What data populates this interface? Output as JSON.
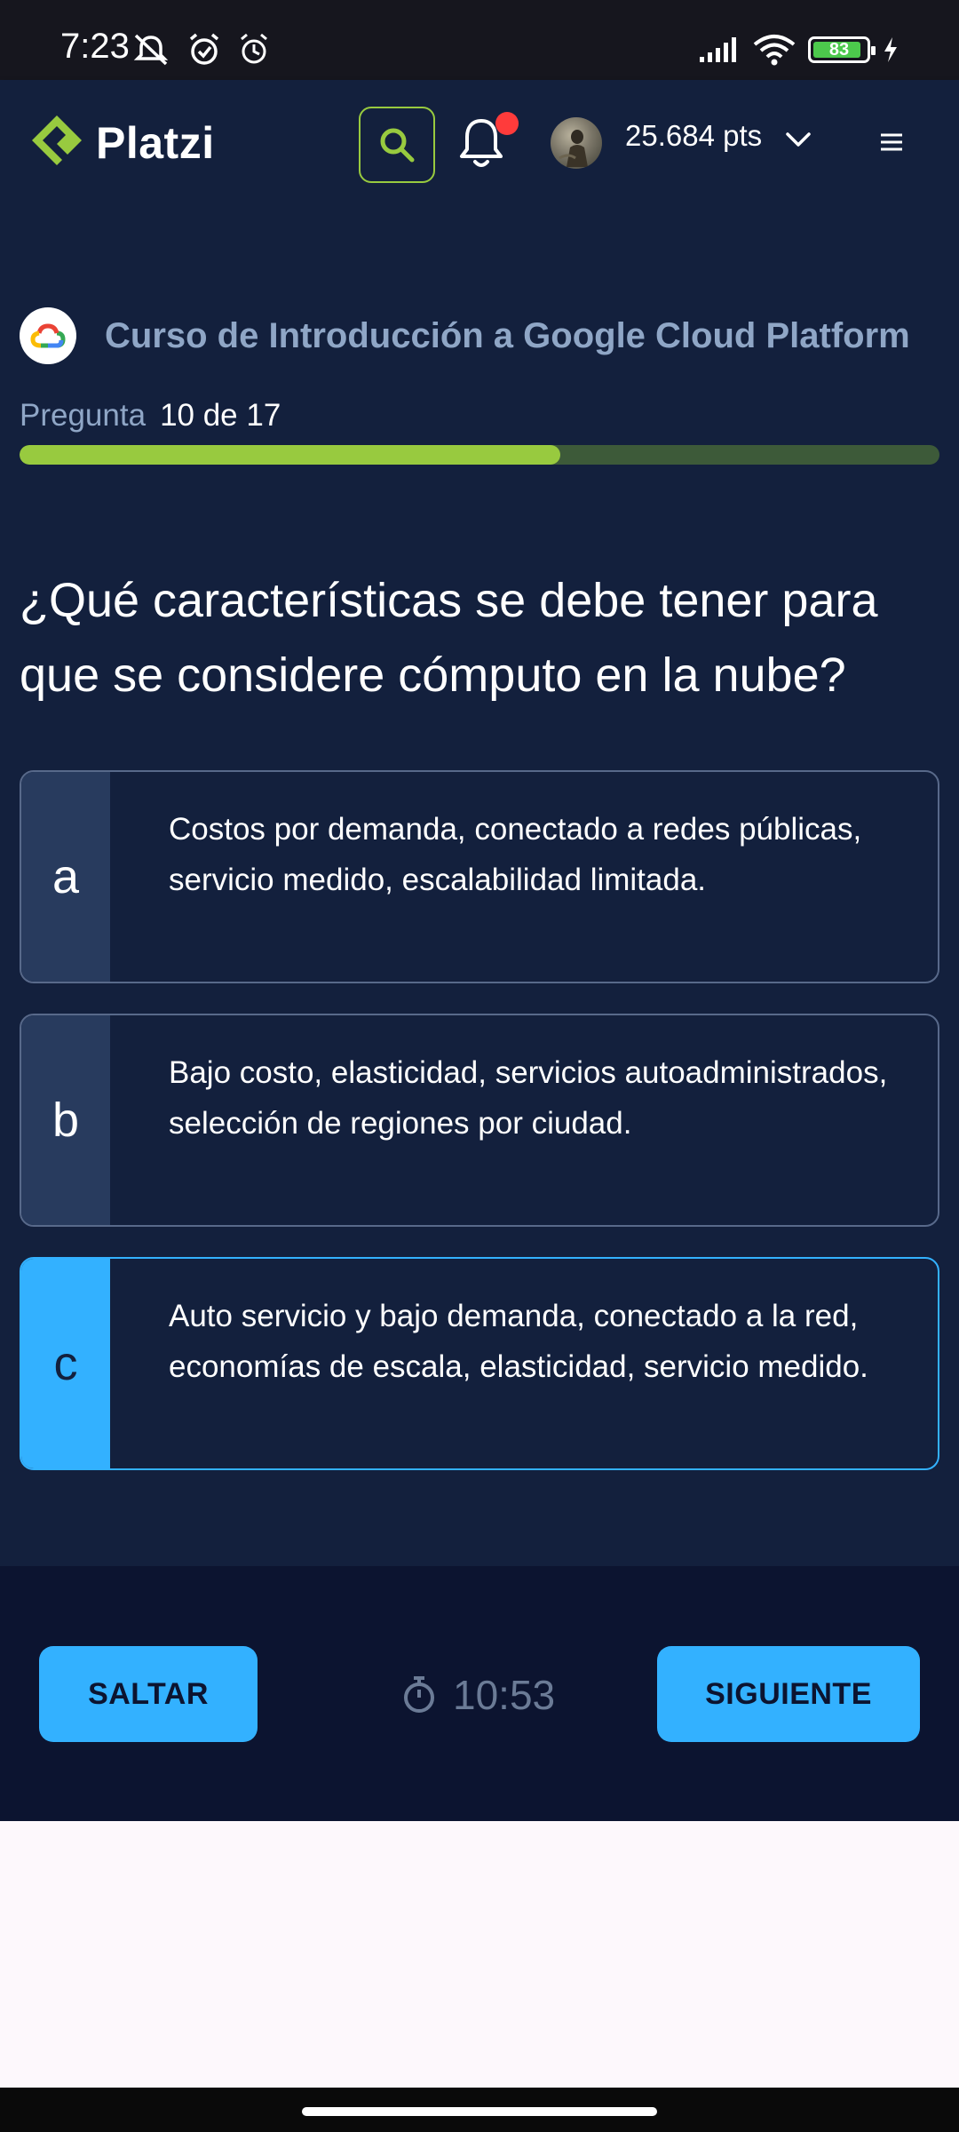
{
  "status_bar": {
    "time": "7:23",
    "battery": "83"
  },
  "header": {
    "logo_text": "Platzi",
    "points": "25.684 pts",
    "colors": {
      "accent": "#98ca3f",
      "notification": "#ff3b3b"
    }
  },
  "quiz": {
    "course_title": "Curso de Introducción a Google Cloud Platform",
    "progress_label": "Pregunta",
    "progress_value": "10 de 17",
    "progress_fraction": 0.588,
    "question": "¿Qué características se debe tener para que se considere cómputo en la nube?",
    "options": [
      {
        "letter": "a",
        "text": "Costos por demanda, conectado a redes públicas, servicio medido, escalabilidad limitada.",
        "selected": false
      },
      {
        "letter": "b",
        "text": "Bajo costo, elasticidad, servicios autoadministrados, selección de regiones por ciudad.",
        "selected": false
      },
      {
        "letter": "c",
        "text": "Auto servicio y bajo demanda, conectado a la red, economías de escala, elasticidad, servicio medido.",
        "selected": true
      }
    ]
  },
  "footer": {
    "skip_label": "SALTAR",
    "next_label": "SIGUIENTE",
    "timer": "10:53"
  },
  "icons": [
    "mute-icon",
    "alarm-icon",
    "alarm-outline-icon",
    "signal-icon",
    "wifi-icon",
    "charging-icon",
    "search-icon",
    "bell-icon",
    "chevron-down-icon",
    "menu-icon",
    "google-cloud-icon",
    "stopwatch-icon"
  ]
}
